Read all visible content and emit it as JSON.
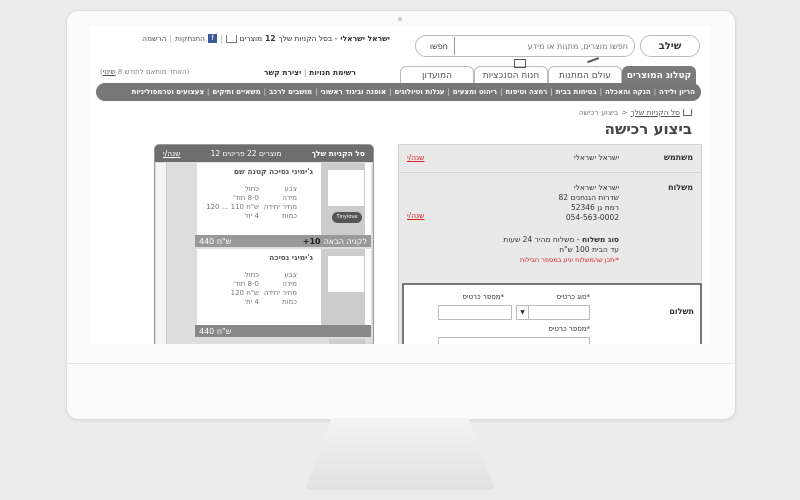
{
  "header": {
    "logo": "שילב",
    "search_button": "חפשו",
    "search_placeholder": "חפשו מוצרים, מתנות או מידע",
    "greeting": "ישראל ישראלי",
    "cart_prefix": " - בסל הקניות שלך",
    "cart_count": "12",
    "cart_suffix": "מוצרים",
    "logout": "התנתקות",
    "register": "הרשמה"
  },
  "tabs": [
    "קטלוג המוצרים",
    "עולם המתנות",
    "חנות הסנכציות",
    "המועדון"
  ],
  "sublinks": [
    "רשימת חנויות",
    "יצירת קשר"
  ],
  "mobile_note": "(האתר מותאם לחודש 8 ",
  "mobile_note_link": "שינוי",
  "mobile_note_end": ")",
  "nav": [
    "הריון ולידה",
    "הנקה והאכלה",
    "בטיחות בבית",
    "רחצה וטיפוח",
    "ריהוט ומצעים",
    "עגלות וטיולונים",
    "אופנה וביגוד ראשוני",
    "מושבים לרכב",
    "משאיים ותיקים",
    "צעצועים וטרמפוליניות"
  ],
  "breadcrumb": {
    "home_icon": "home-icon",
    "link": "סל הקניות שלך",
    "current": "ביצוע רכישה"
  },
  "page_title": "ביצוע רכישה",
  "checkout": {
    "user_label": "משתמש",
    "user_name": "ישראל ישראלי",
    "change": "שנה/י",
    "shipping_label": "משלוח",
    "address_lines": [
      "ישראל ישראלי",
      "שדרות הגנחנים 82",
      "רמת גן 52346",
      "054-563-0002"
    ],
    "ship_type_label": "סוג משלוח",
    "ship_type_value": " - משלוח מהיר 24 שעות",
    "ship_price": "עד הבית 100 ש\"ח",
    "ship_note": "*יתכן שהמשלוח יגיע במספר חבילות",
    "payment_label": "תשלום",
    "card_type_label": "*סוג כרטיס",
    "card_num_label": "*מספר כרטיס",
    "card_num_label2": "*מספר כרטיס"
  },
  "cart": {
    "title": "סל הקניות שלך",
    "count_text": "מוצרים 22 פריטים 12",
    "change": "שנה/י",
    "items": [
      {
        "name": "ג'ימיני נסיכה קטנה שם",
        "labels": [
          "צבע",
          "מידה",
          "מחיר יחידה",
          "כמות"
        ],
        "values": [
          "כחול",
          "8-0 חוד'",
          "ש\"ח 110 ... 120",
          "4 יח'"
        ],
        "badge": "Tinylove",
        "promo_qty": "10+",
        "promo_text": "לקניה הבאה",
        "subtotal": "ש\"ח 440"
      },
      {
        "name": "ג'ימיני נסיכה",
        "labels": [
          "צבע",
          "מידה",
          "מחיר יחידה",
          "כמות"
        ],
        "values": [
          "כחול",
          "8-0 חוד'",
          "ש\"ח 120",
          "4 יח'"
        ],
        "subtotal": "ש\"ח 440"
      }
    ]
  }
}
